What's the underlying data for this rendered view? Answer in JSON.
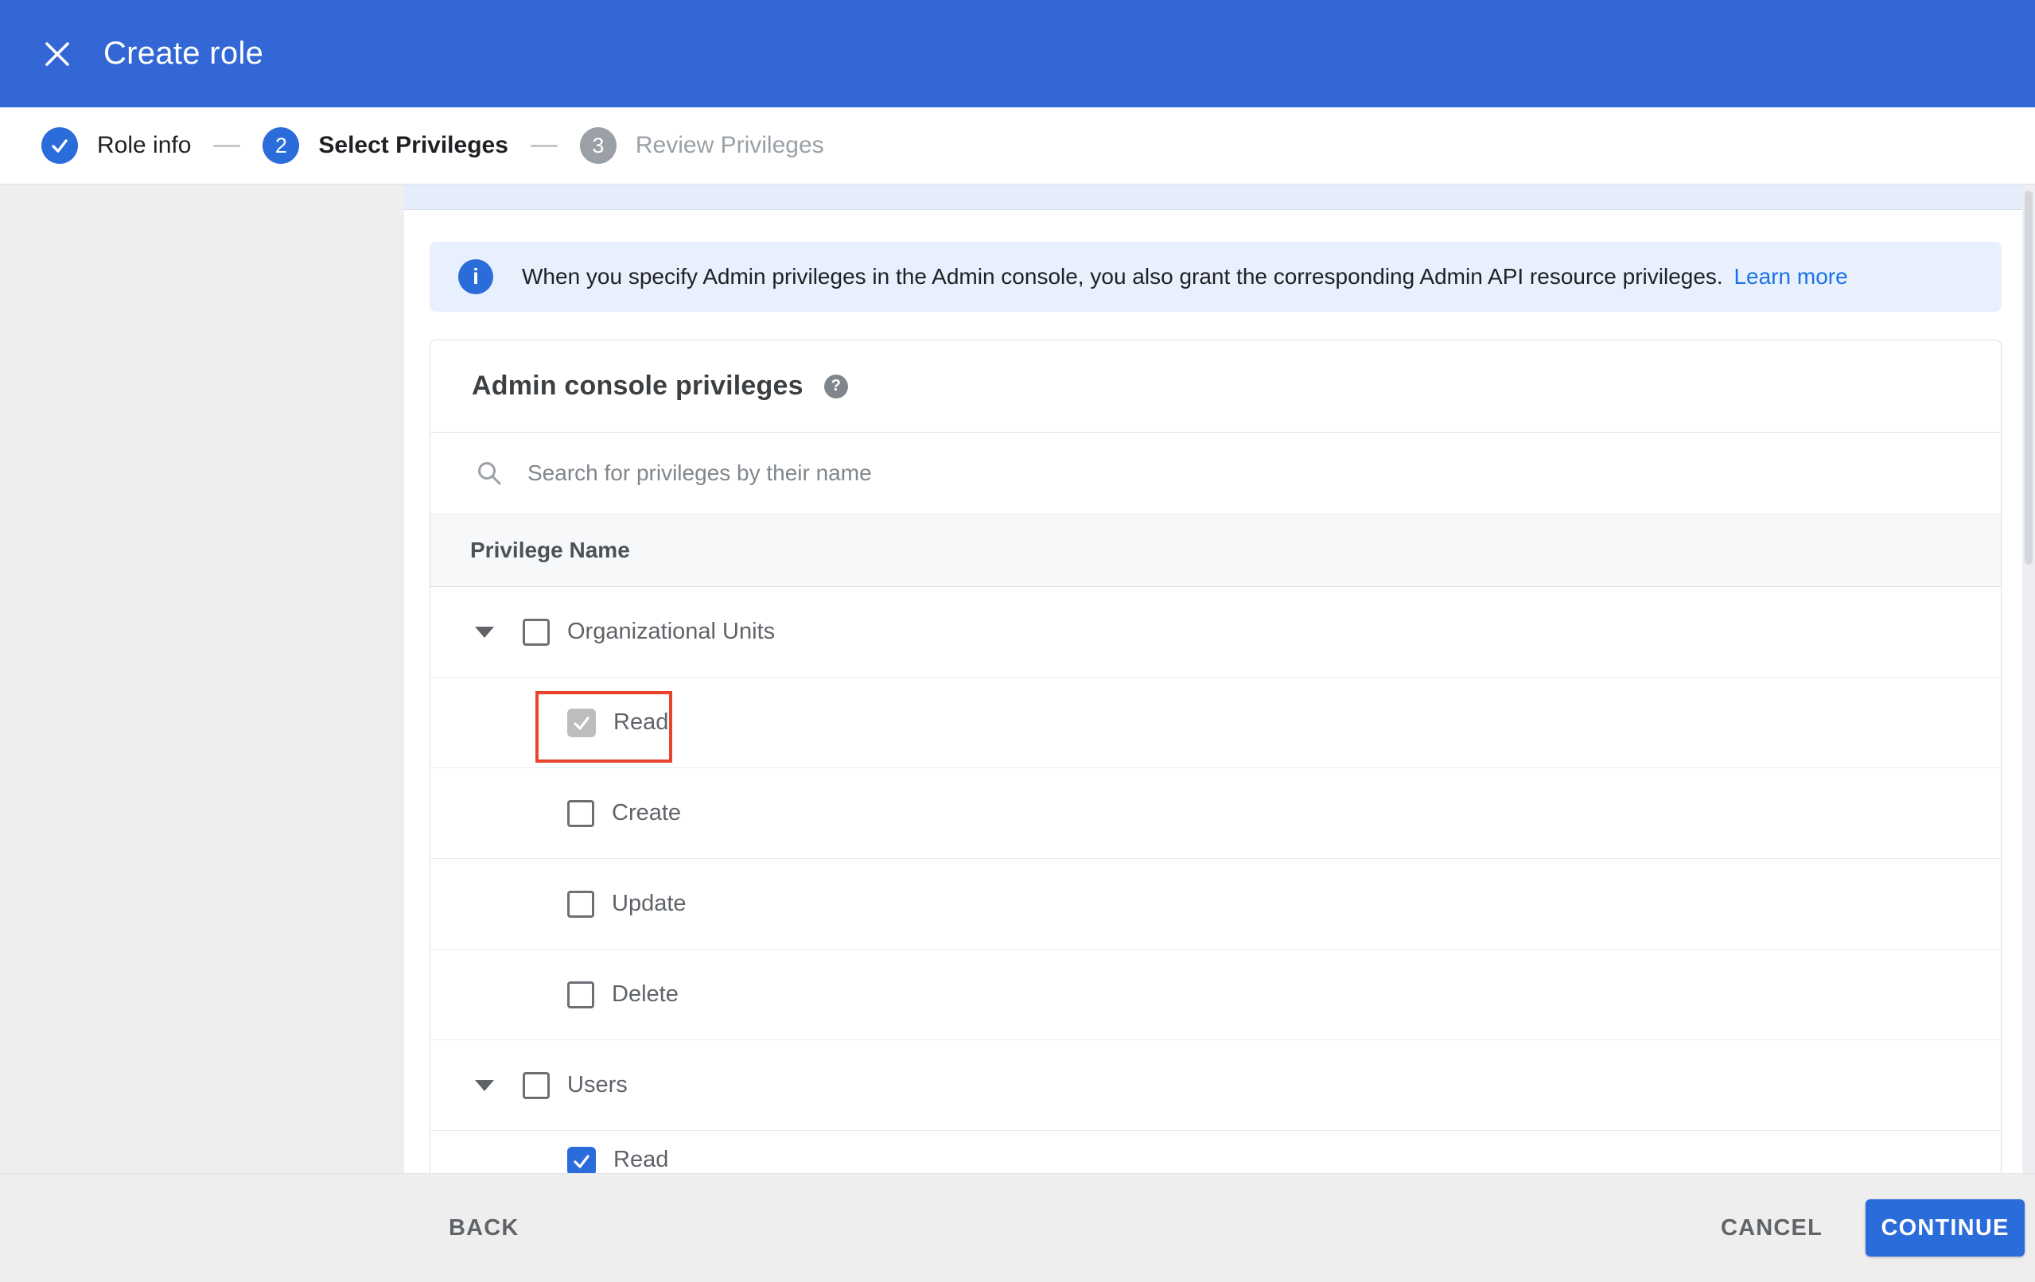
{
  "header": {
    "title": "Create role",
    "close_icon": "close-x"
  },
  "stepper": {
    "steps": [
      {
        "label": "Role info",
        "indicator": "check",
        "state": "complete"
      },
      {
        "label": "Select Privileges",
        "indicator": "2",
        "state": "active"
      },
      {
        "label": "Review Privileges",
        "indicator": "3",
        "state": "upcoming"
      }
    ]
  },
  "banner": {
    "icon": "info-icon",
    "icon_glyph": "i",
    "text": "When you specify Admin privileges in the Admin console, you also grant the corresponding Admin API resource privileges.",
    "link_label": "Learn more"
  },
  "privileges_card": {
    "title": "Admin console privileges",
    "help_icon_glyph": "?",
    "search": {
      "icon": "search-icon",
      "placeholder": "Search for privileges by their name",
      "value": ""
    },
    "table": {
      "column_header": "Privilege Name",
      "rows": [
        {
          "label": "Organizational Units",
          "level": "parent",
          "expanded": true,
          "checked": false
        },
        {
          "label": "Read",
          "level": "child",
          "checked": true,
          "disabled": true,
          "highlighted": true
        },
        {
          "label": "Create",
          "level": "child",
          "checked": false
        },
        {
          "label": "Update",
          "level": "child",
          "checked": false
        },
        {
          "label": "Delete",
          "level": "child",
          "checked": false
        },
        {
          "label": "Users",
          "level": "parent",
          "expanded": true,
          "checked": false
        },
        {
          "label": "Read",
          "level": "child",
          "checked": true,
          "clipped": true
        }
      ]
    }
  },
  "footer": {
    "back_label": "BACK",
    "cancel_label": "CANCEL",
    "continue_label": "CONTINUE"
  },
  "colors": {
    "header_blue": "#3367d6",
    "accent_blue": "#2b6cdb",
    "link_blue": "#1a73e8",
    "banner_bg": "#e8f0fe",
    "highlight_red": "#e8442c",
    "disabled_check_gray": "#bdbdbd"
  }
}
